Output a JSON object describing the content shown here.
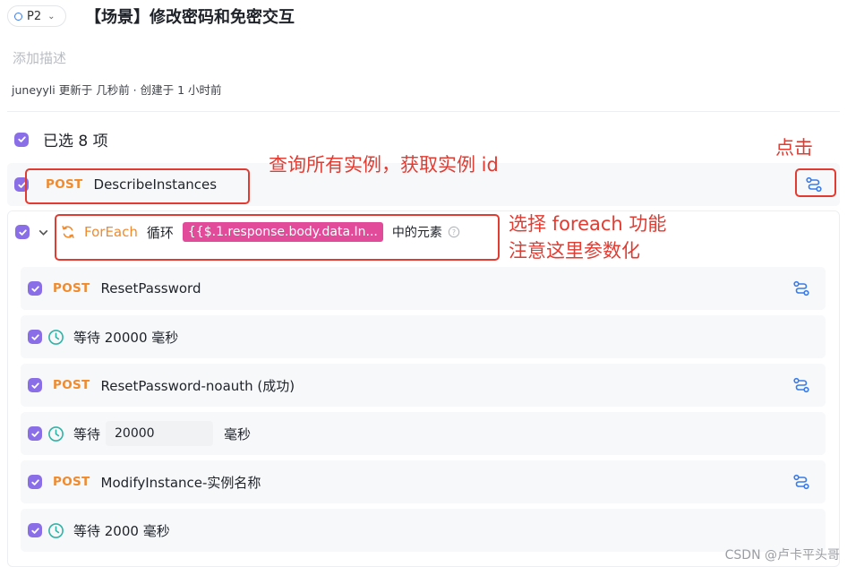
{
  "header": {
    "priority": "P2",
    "title": "【场景】修改密码和免密交互",
    "description_placeholder": "添加描述",
    "meta": "juneyyli 更新于 几秒前 · 创建于 1 小时前"
  },
  "selection": {
    "label": "已选 8 项"
  },
  "steps": {
    "describe": {
      "method": "POST",
      "name": "DescribeInstances"
    },
    "foreach": {
      "keyword": "ForEach",
      "loop_label": "循环",
      "param": "{{$.1.response.body.data.In...",
      "suffix": "中的元素"
    },
    "reset": {
      "method": "POST",
      "name": "ResetPassword"
    },
    "wait1": {
      "label": "等待 20000 毫秒"
    },
    "reset_noauth": {
      "method": "POST",
      "name": "ResetPassword-noauth (成功)"
    },
    "wait2": {
      "prefix": "等待",
      "value": "20000",
      "suffix": "毫秒"
    },
    "modify": {
      "method": "POST",
      "name": "ModifyInstance-实例名称"
    },
    "wait3": {
      "label": "等待 2000 毫秒"
    }
  },
  "annotations": {
    "query": "查询所有实例，获取实例 id",
    "click": "点击",
    "foreach_line1": "选择 foreach 功能",
    "foreach_line2": "注意这里参数化"
  },
  "watermark": "CSDN @卢卡平头哥",
  "colors": {
    "accent": "#8a6ee8",
    "method": "#f08a2c",
    "annotation": "#e23b32",
    "param": "#e24a9a",
    "link": "#3a7ce8"
  }
}
